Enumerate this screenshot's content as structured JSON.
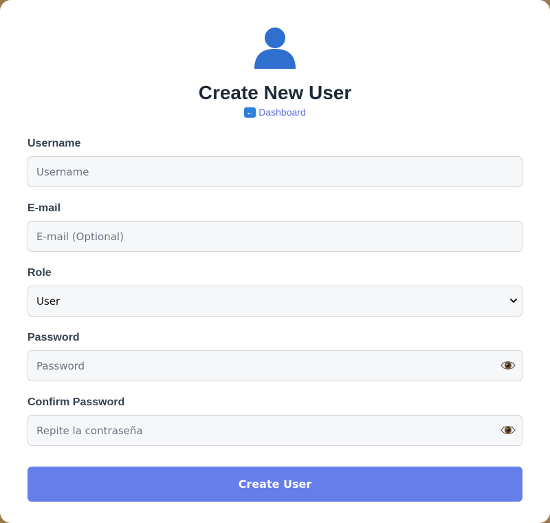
{
  "header": {
    "avatar_icon": "user-silhouette-icon",
    "title": "Create New User",
    "back_icon": "back-arrow-icon",
    "back_link": "Dashboard"
  },
  "form": {
    "username": {
      "label": "Username",
      "placeholder": "Username",
      "value": ""
    },
    "email": {
      "label": "E-mail",
      "placeholder": "E-mail (Optional)",
      "value": ""
    },
    "role": {
      "label": "Role",
      "selected": "User"
    },
    "password": {
      "label": "Password",
      "placeholder": "Password",
      "toggle_icon": "eye-icon"
    },
    "confirm_password": {
      "label": "Confirm Password",
      "placeholder": "Repite la contraseña",
      "toggle_icon": "eye-icon"
    },
    "submit_label": "Create User"
  },
  "colors": {
    "accent": "#667eea",
    "link": "#5b6ee1",
    "title": "#1f2937",
    "avatar": "#2f6fcf"
  }
}
